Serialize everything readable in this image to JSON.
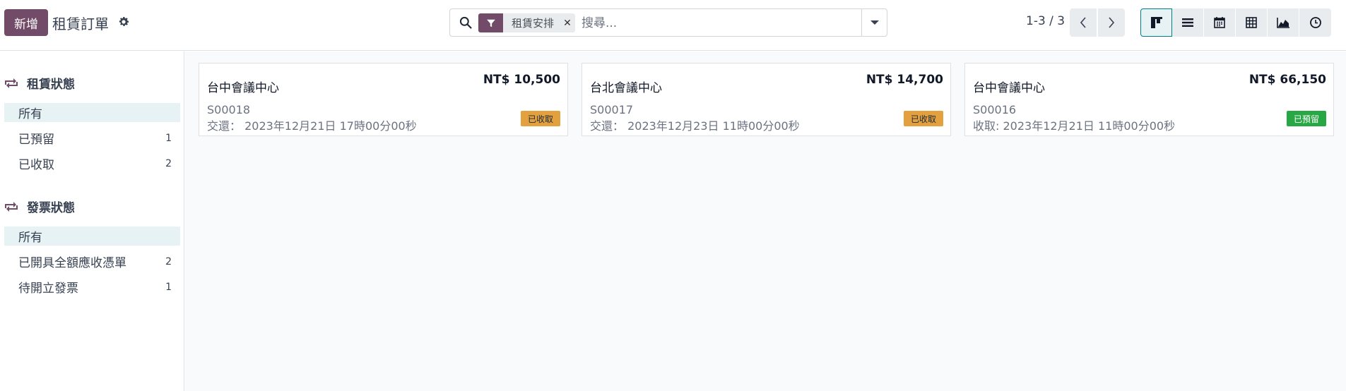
{
  "header": {
    "new_button": "新增",
    "breadcrumb": "租賃訂單",
    "search": {
      "facet_label": "租賃安排",
      "placeholder": "搜尋..."
    },
    "pager": "1-3 / 3"
  },
  "views": [
    "kanban",
    "list",
    "calendar",
    "pivot",
    "graph",
    "activity"
  ],
  "sidebar": {
    "sections": [
      {
        "title": "租賃狀態",
        "items": [
          {
            "label": "所有",
            "count": ""
          },
          {
            "label": "已預留",
            "count": "1"
          },
          {
            "label": "已收取",
            "count": "2"
          }
        ]
      },
      {
        "title": "發票狀態",
        "items": [
          {
            "label": "所有",
            "count": ""
          },
          {
            "label": "已開具全額應收憑單",
            "count": "2"
          },
          {
            "label": "待開立發票",
            "count": "1"
          }
        ]
      }
    ]
  },
  "cards": [
    {
      "title": "台中會議中心",
      "amount": "NT$ 10,500",
      "ref": "S00018",
      "date": "交還： 2023年12月21日 17時00分00秒",
      "status": "已收取",
      "status_color": "#e2a03f"
    },
    {
      "title": "台北會議中心",
      "amount": "NT$ 14,700",
      "ref": "S00017",
      "date": "交還： 2023年12月23日 11時00分00秒",
      "status": "已收取",
      "status_color": "#e2a03f"
    },
    {
      "title": "台中會議中心",
      "amount": "NT$ 66,150",
      "ref": "S00016",
      "date": "收取: 2023年12月21日 11時00分00秒",
      "status": "已預留",
      "status_color": "#28a745"
    }
  ],
  "colors": {
    "primary": "#714b67",
    "active_bg": "#e6f2f3",
    "active_border": "#017e84"
  }
}
